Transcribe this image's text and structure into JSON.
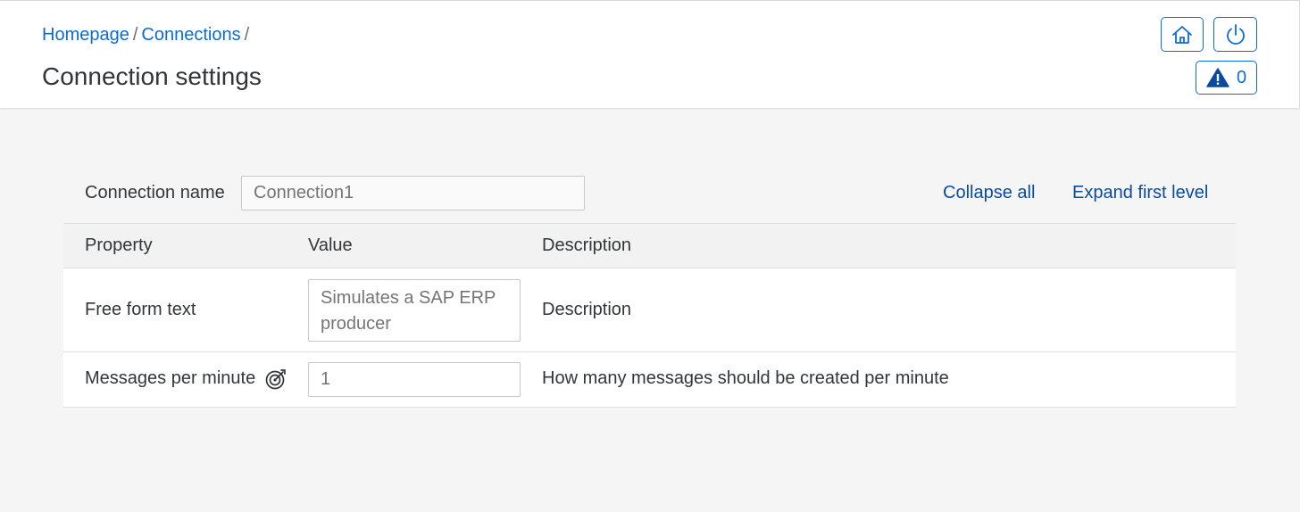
{
  "breadcrumb": {
    "items": [
      "Homepage",
      "Connections"
    ],
    "separator": "/"
  },
  "page_title": "Connection settings",
  "header_buttons": {
    "home_icon": "home-icon",
    "power_icon": "power-icon",
    "warning_icon": "warning-triangle-icon",
    "warning_count": "0"
  },
  "connection": {
    "label": "Connection name",
    "placeholder": "Connection1"
  },
  "links": {
    "collapse_all": "Collapse all",
    "expand_first_level": "Expand first level"
  },
  "table": {
    "headers": [
      "Property",
      "Value",
      "Description"
    ],
    "rows": [
      {
        "property": "Free form text",
        "value_placeholder": "Simulates a SAP ERP producer",
        "description": "Description"
      },
      {
        "property": "Messages per minute",
        "property_icon": "target-icon",
        "value_placeholder": "1",
        "description": "How many messages should be created per minute"
      }
    ]
  },
  "colors": {
    "accent": "#0a6ed1",
    "link": "#0a4b9e",
    "background": "#f5f5f5",
    "text": "#32363a"
  }
}
